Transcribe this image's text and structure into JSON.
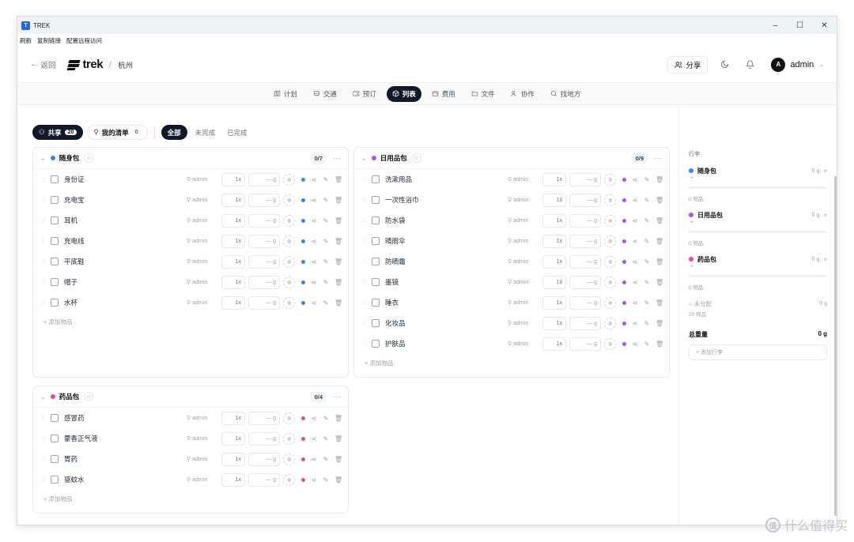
{
  "window": {
    "title": "TREK",
    "controls": [
      "–",
      "☐",
      "✕"
    ]
  },
  "menubar": [
    "刷新",
    "复制链接",
    "配置远程访问"
  ],
  "header": {
    "back_label": "返回",
    "logo_text": "trek",
    "trip_name": "杭州",
    "share_label": "分享",
    "user_initial": "A",
    "user_name": "admin"
  },
  "tabs": [
    {
      "label": "计划",
      "icon": "map-icon"
    },
    {
      "label": "交通",
      "icon": "transport-icon"
    },
    {
      "label": "预订",
      "icon": "ticket-icon"
    },
    {
      "label": "列表",
      "icon": "package-icon",
      "active": true
    },
    {
      "label": "费用",
      "icon": "wallet-icon"
    },
    {
      "label": "文件",
      "icon": "folder-icon"
    },
    {
      "label": "协作",
      "icon": "users-icon"
    },
    {
      "label": "找地方",
      "icon": "search-icon"
    }
  ],
  "filters": {
    "shared_label": "共享",
    "shared_count": "20",
    "mine_label": "我的清单",
    "mine_count": "0",
    "all_label": "全部",
    "incomplete_label": "未完成",
    "complete_label": "已完成"
  },
  "common": {
    "owner": "admin",
    "qty": "1x",
    "weight": "— g",
    "add_item": "+ 添加物品",
    "more": "···"
  },
  "groups": [
    {
      "name": "随身包",
      "color": "#3b82f6",
      "count": "0/7",
      "items": [
        "身份证",
        "充电宝",
        "耳机",
        "充电线",
        "平底鞋",
        "帽子",
        "水杯"
      ]
    },
    {
      "name": "日用品包",
      "color": "#a855f7",
      "count": "0/9",
      "items": [
        "洗漱用品",
        "一次性浴巾",
        "防水袋",
        "晴雨伞",
        "防晒霜",
        "墨镜",
        "睡衣",
        "化妆品",
        "护肤品"
      ]
    },
    {
      "name": "药品包",
      "color": "#ec4899",
      "count": "0/4",
      "items": [
        "感冒药",
        "藿香正气液",
        "胃药",
        "驱蚊水"
      ]
    }
  ],
  "sidebar": {
    "title": "行李",
    "bags": [
      {
        "name": "随身包",
        "color": "#3b82f6",
        "weight": "0 g",
        "items": "0 物品"
      },
      {
        "name": "日用品包",
        "color": "#a855f7",
        "weight": "0 g",
        "items": "0 物品"
      },
      {
        "name": "药品包",
        "color": "#ec4899",
        "weight": "0 g",
        "items": "0 物品"
      }
    ],
    "unassigned": {
      "label": "未分配",
      "weight": "0 g",
      "items": "20 物品"
    },
    "total_label": "总重量",
    "total_weight": "0 g",
    "add_bag": "+ 添加行李"
  },
  "watermark": {
    "symbol": "值",
    "text": "什么值得买"
  }
}
